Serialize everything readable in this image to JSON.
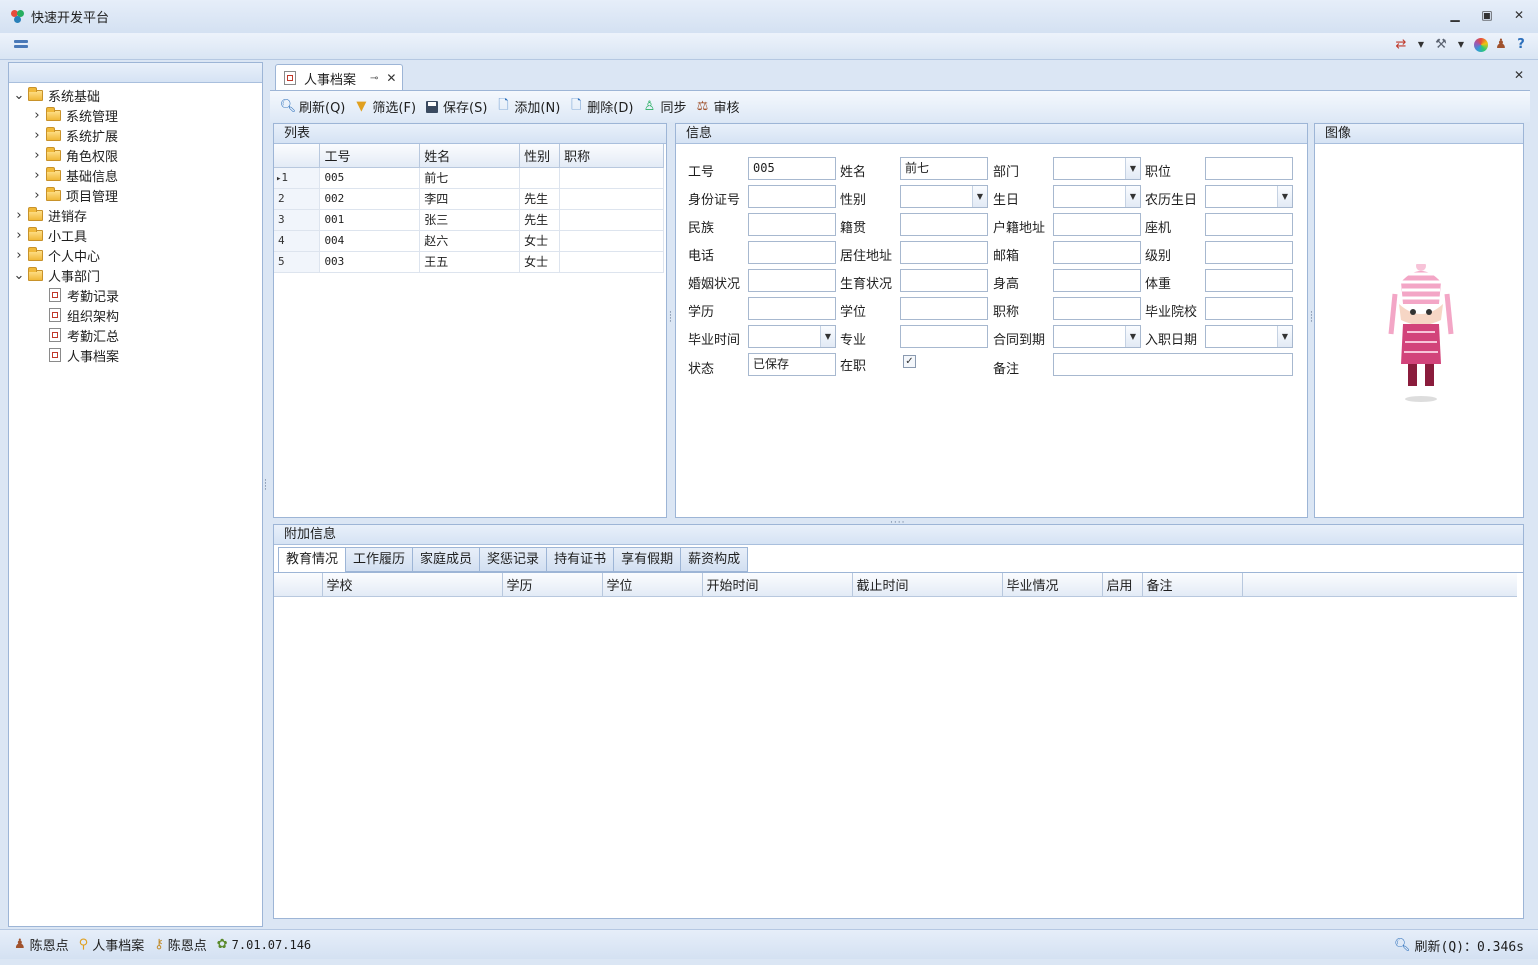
{
  "app": {
    "title": "快速开发平台"
  },
  "window": {
    "min": "▭",
    "max": "⧉",
    "close": "✕"
  },
  "toolbar_top": {
    "icons": [
      "translate-icon",
      "tools-icon",
      "color-wheel-icon",
      "users-icon",
      "help-icon"
    ]
  },
  "sidebar": {
    "items": [
      {
        "label": "系统基础",
        "level": 0,
        "expanded": true,
        "type": "folder"
      },
      {
        "label": "系统管理",
        "level": 1,
        "expanded": false,
        "type": "folder"
      },
      {
        "label": "系统扩展",
        "level": 1,
        "expanded": false,
        "type": "folder"
      },
      {
        "label": "角色权限",
        "level": 1,
        "expanded": false,
        "type": "folder"
      },
      {
        "label": "基础信息",
        "level": 1,
        "expanded": false,
        "type": "folder"
      },
      {
        "label": "项目管理",
        "level": 1,
        "expanded": false,
        "type": "folder"
      },
      {
        "label": "进销存",
        "level": 0,
        "expanded": false,
        "type": "folder"
      },
      {
        "label": "小工具",
        "level": 0,
        "expanded": false,
        "type": "folder"
      },
      {
        "label": "个人中心",
        "level": 0,
        "expanded": false,
        "type": "folder"
      },
      {
        "label": "人事部门",
        "level": 0,
        "expanded": true,
        "type": "folder"
      },
      {
        "label": "考勤记录",
        "level": 1,
        "type": "doc"
      },
      {
        "label": "组织架构",
        "level": 1,
        "type": "doc"
      },
      {
        "label": "考勤汇总",
        "level": 1,
        "type": "doc"
      },
      {
        "label": "人事档案",
        "level": 1,
        "type": "doc"
      }
    ]
  },
  "tab": {
    "label": "人事档案",
    "pin": "⊸",
    "close": "✕",
    "close_all": "✕"
  },
  "toolbar": {
    "refresh": "刷新(Q)",
    "filter": "筛选(F)",
    "save": "保存(S)",
    "add": "添加(N)",
    "delete": "删除(D)",
    "sync": "同步",
    "audit": "审核"
  },
  "list": {
    "title": "列表",
    "columns": [
      "工号",
      "姓名",
      "性别",
      "职称"
    ],
    "rows": [
      {
        "n": "1",
        "id": "005",
        "name": "前七",
        "gender": "",
        "title": ""
      },
      {
        "n": "2",
        "id": "002",
        "name": "李四",
        "gender": "先生",
        "title": ""
      },
      {
        "n": "3",
        "id": "001",
        "name": "张三",
        "gender": "先生",
        "title": ""
      },
      {
        "n": "4",
        "id": "004",
        "name": "赵六",
        "gender": "女士",
        "title": ""
      },
      {
        "n": "5",
        "id": "003",
        "name": "王五",
        "gender": "女士",
        "title": ""
      }
    ]
  },
  "info": {
    "title": "信息",
    "labels": {
      "emp_id": "工号",
      "name": "姓名",
      "dept": "部门",
      "position": "职位",
      "id_card": "身份证号",
      "gender": "性别",
      "birthday": "生日",
      "lunar_birthday": "农历生日",
      "ethnicity": "民族",
      "native_place": "籍贯",
      "household_addr": "户籍地址",
      "landline": "座机",
      "phone": "电话",
      "home_addr": "居住地址",
      "email": "邮箱",
      "level": "级别",
      "marital": "婚姻状况",
      "fertility": "生育状况",
      "height": "身高",
      "weight": "体重",
      "education": "学历",
      "degree": "学位",
      "job_title": "职称",
      "school": "毕业院校",
      "grad_time": "毕业时间",
      "major": "专业",
      "contract_expiry": "合同到期",
      "hire_date": "入职日期",
      "status": "状态",
      "employed": "在职",
      "remarks": "备注"
    },
    "values": {
      "emp_id": "005",
      "name": "前七",
      "status": "已保存",
      "employed": true
    }
  },
  "image_panel": {
    "title": "图像"
  },
  "extra": {
    "title": "附加信息",
    "tabs": [
      "教育情况",
      "工作履历",
      "家庭成员",
      "奖惩记录",
      "持有证书",
      "享有假期",
      "薪资构成"
    ],
    "active_tab": 0,
    "columns": [
      "学校",
      "学历",
      "学位",
      "开始时间",
      "截止时间",
      "毕业情况",
      "启用",
      "备注"
    ]
  },
  "status": {
    "user": "陈恩点",
    "module": "人事档案",
    "user2": "陈恩点",
    "version": "7.01.07.146",
    "refresh": "刷新(Q)：0.346s"
  }
}
